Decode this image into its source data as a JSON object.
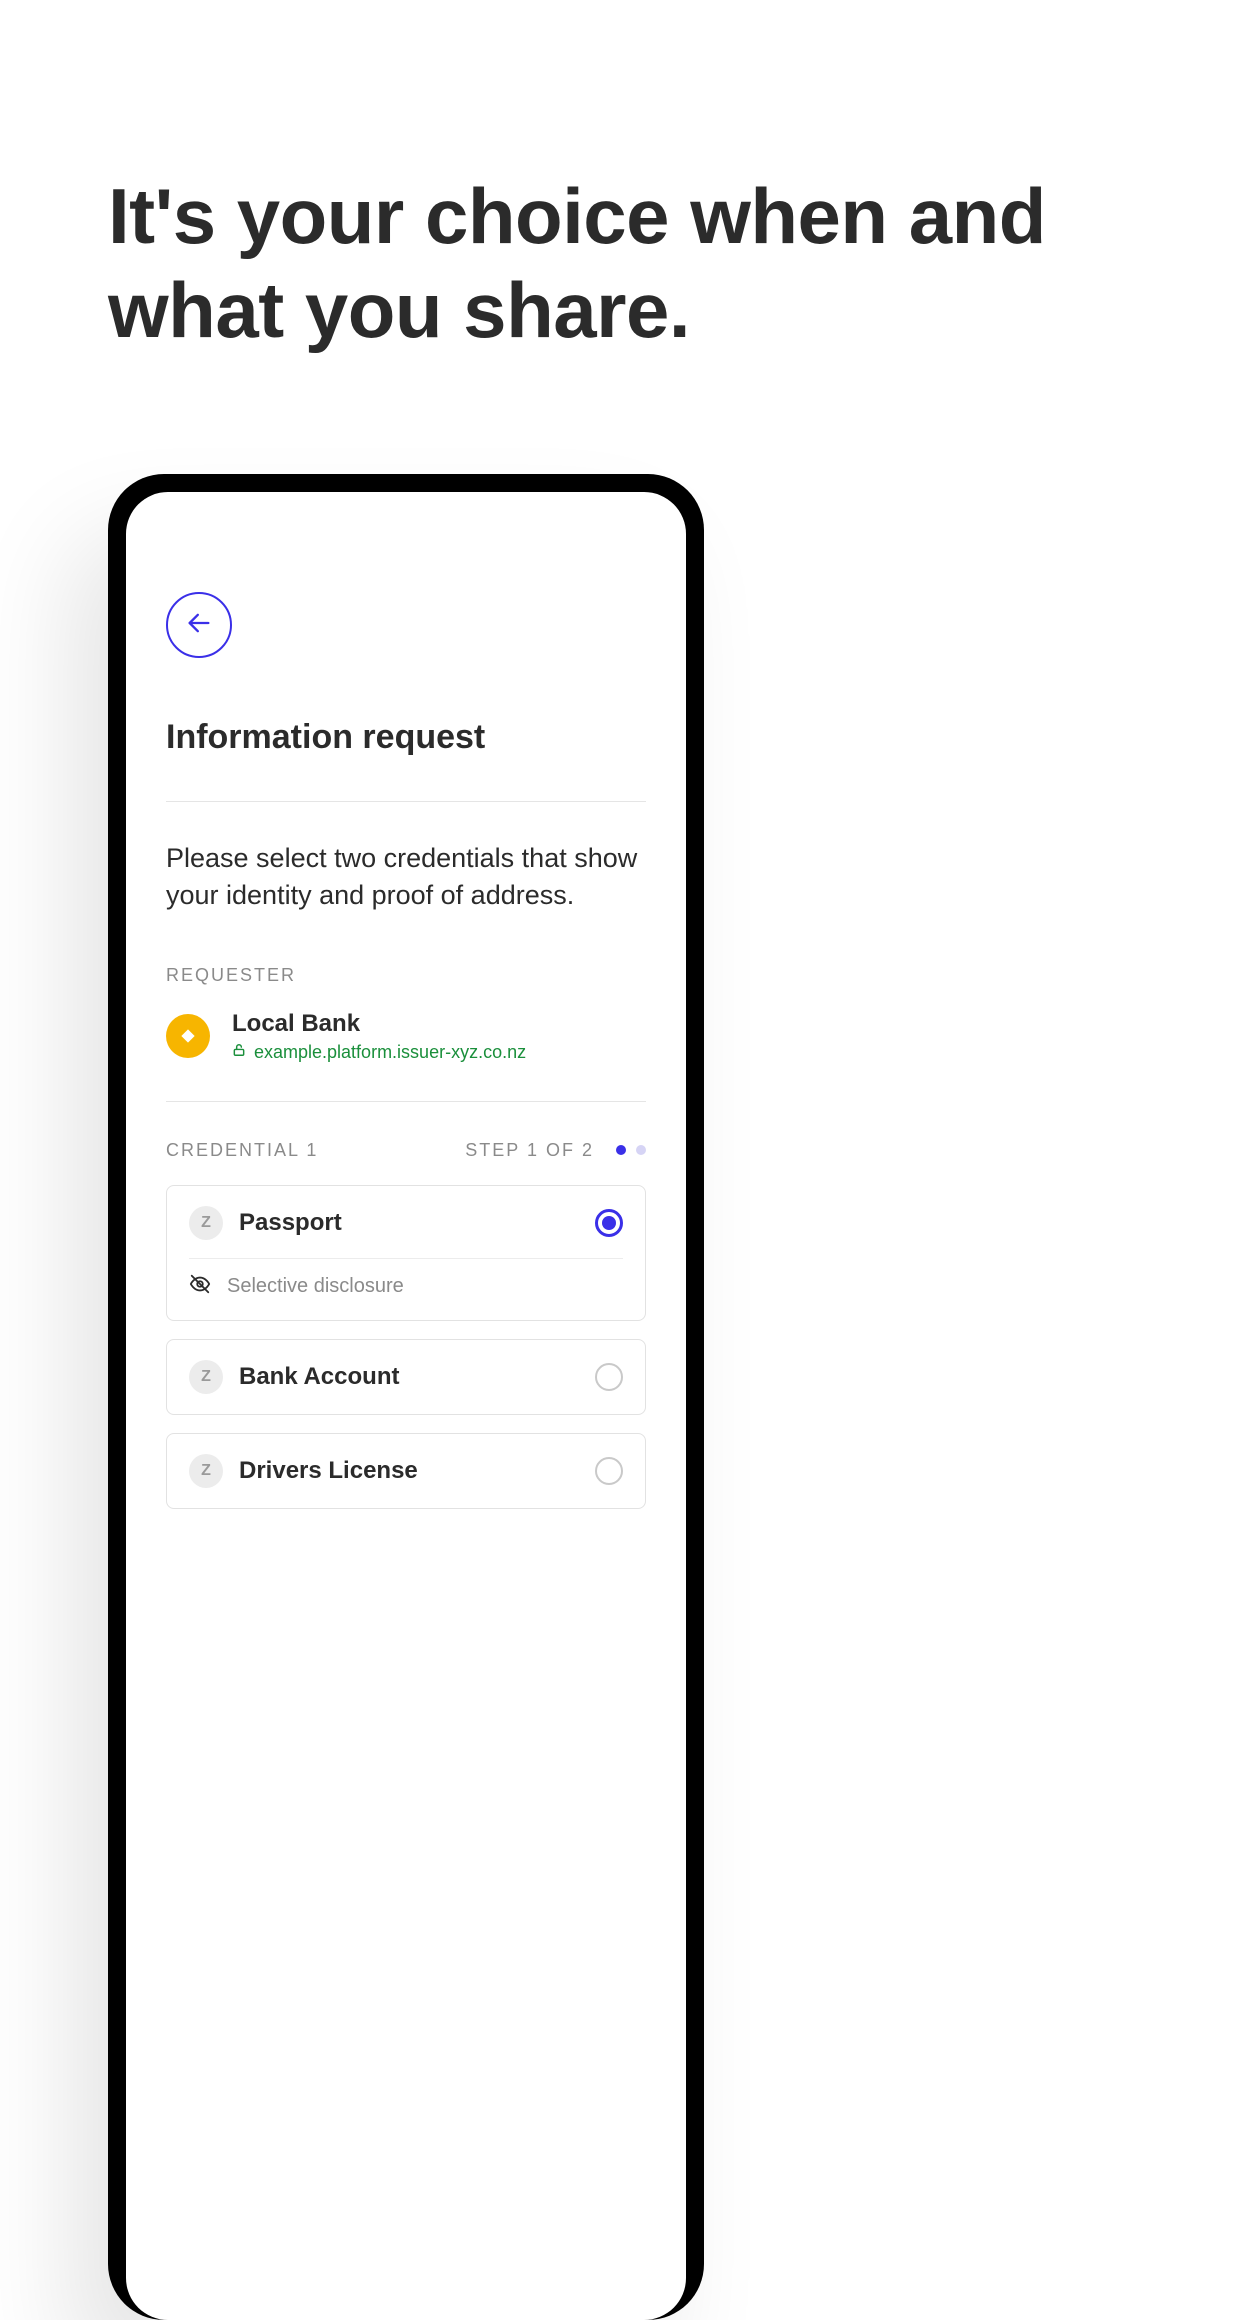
{
  "hero": {
    "title": "It's your choice when and what you share."
  },
  "screen": {
    "title": "Information request",
    "instructions": "Please select two credentials that show your identity and proof of address.",
    "requester_label": "REQUESTER",
    "requester": {
      "name": "Local Bank",
      "url": "example.platform.issuer-xyz.co.nz"
    },
    "credential_label": "CREDENTIAL 1",
    "step_text": "STEP 1 OF 2",
    "dots": {
      "active_index": 0,
      "count": 2
    },
    "credentials": [
      {
        "icon_letter": "Z",
        "name": "Passport",
        "selected": true,
        "disclosure": "Selective disclosure"
      },
      {
        "icon_letter": "Z",
        "name": "Bank Account",
        "selected": false
      },
      {
        "icon_letter": "Z",
        "name": "Drivers License",
        "selected": false
      }
    ]
  },
  "colors": {
    "accent": "#3a2fe8",
    "brand_badge": "#f7b500",
    "green": "#1a8f3b"
  }
}
